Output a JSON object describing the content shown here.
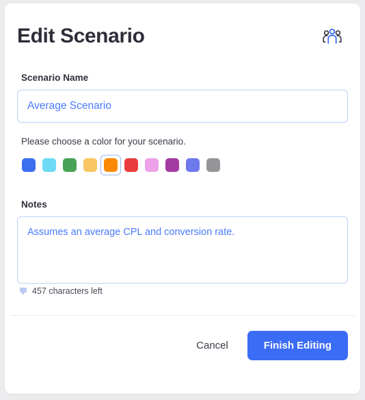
{
  "modal": {
    "title": "Edit Scenario",
    "header_icon": "people-group-icon",
    "accent_color": "#3b6cf6"
  },
  "scenario_name": {
    "label": "Scenario Name",
    "value": "Average Scenario",
    "placeholder": "Scenario Name"
  },
  "color_picker": {
    "helper_text": "Please choose a color for your scenario.",
    "selected_index": 4,
    "swatches": [
      {
        "name": "blue",
        "hex": "#3c6ef0"
      },
      {
        "name": "light-blue",
        "hex": "#6cdaf4"
      },
      {
        "name": "green",
        "hex": "#47a356"
      },
      {
        "name": "yellow",
        "hex": "#f8c763"
      },
      {
        "name": "orange",
        "hex": "#fa8a02"
      },
      {
        "name": "red",
        "hex": "#ea3d3d"
      },
      {
        "name": "pink",
        "hex": "#eda2ea"
      },
      {
        "name": "purple",
        "hex": "#a43ba0"
      },
      {
        "name": "periwinkle",
        "hex": "#6f79ee"
      },
      {
        "name": "gray",
        "hex": "#959599"
      }
    ]
  },
  "notes": {
    "label": "Notes",
    "value": "Assumes an average CPL and conversion rate.",
    "placeholder": "Notes",
    "char_count_text": "457 characters left",
    "resize_grip_icon": "resize-grip-icon"
  },
  "footer": {
    "cancel_label": "Cancel",
    "submit_label": "Finish Editing"
  }
}
